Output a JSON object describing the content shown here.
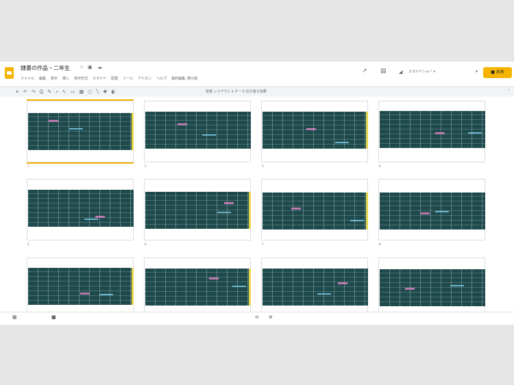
{
  "document": {
    "title": "隷書の作品・二年生",
    "menu": [
      "ファイル",
      "編集",
      "表示",
      "挿入",
      "表示形式",
      "スライド",
      "配置",
      "ツール",
      "アドオン",
      "ヘルプ",
      "最終編集: 数分前"
    ],
    "account_label": "スライドショー ▾",
    "share_label": "共有"
  },
  "toolbar": {
    "text": "背景  レイアウト ▾  テーマ  切り替え効果"
  },
  "slides": [
    {
      "number": "1",
      "selected": true
    },
    {
      "number": "2",
      "selected": false
    },
    {
      "number": "3",
      "selected": false
    },
    {
      "number": "4",
      "selected": false
    },
    {
      "number": "5",
      "selected": false
    },
    {
      "number": "6",
      "selected": false
    },
    {
      "number": "7",
      "selected": false
    },
    {
      "number": "8",
      "selected": false
    },
    {
      "number": "9",
      "selected": false
    },
    {
      "number": "10",
      "selected": false
    },
    {
      "number": "11",
      "selected": false
    },
    {
      "number": "12",
      "selected": false
    }
  ],
  "icons": {
    "star": "star-icon",
    "folder": "folder-icon",
    "cloud": "cloud-icon",
    "comments": "comment-icon",
    "present": "present-icon",
    "lock": "lock-icon"
  },
  "colors": {
    "accent": "#f4b400",
    "board": "#1f4a4c"
  }
}
